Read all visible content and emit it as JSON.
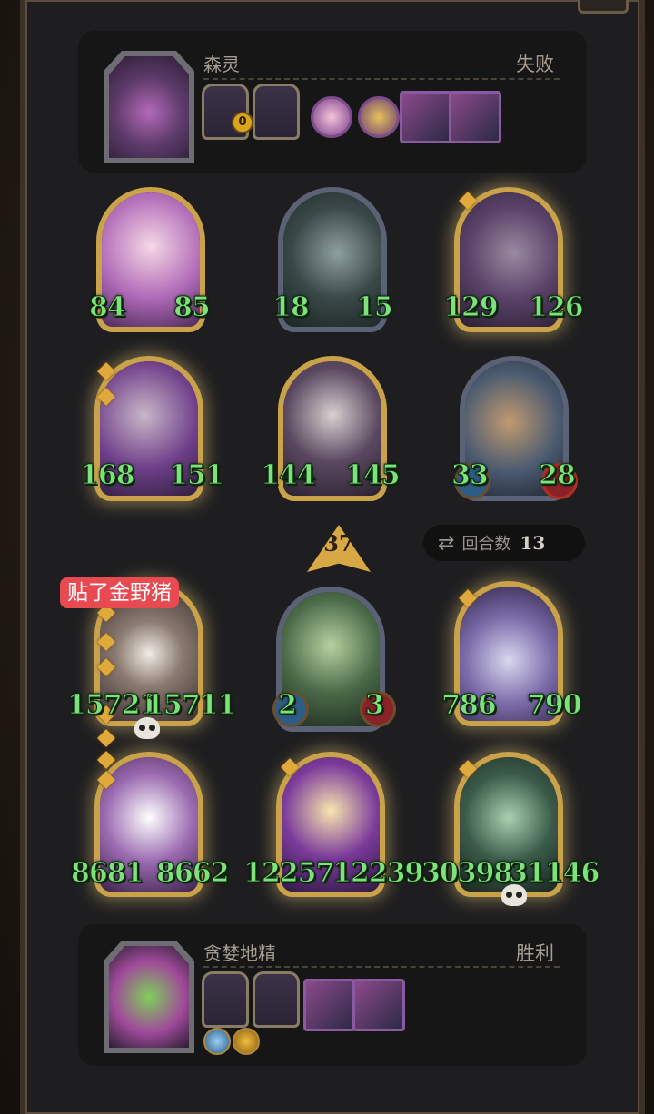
{
  "opponent": {
    "name": "森灵",
    "result": "失败",
    "coin_count": "0"
  },
  "player": {
    "name": "贪婪地精",
    "result": "胜利"
  },
  "tavern_tier": "37",
  "rounds": {
    "label": "回合数",
    "value": "13",
    "icon": "cycle-icon"
  },
  "tag": "贴了金野猪",
  "minions": [
    {
      "attack": "84",
      "health": "85"
    },
    {
      "attack": "18",
      "health": "15"
    },
    {
      "attack": "129",
      "health": "126"
    },
    {
      "attack": "168",
      "health": "151"
    },
    {
      "attack": "144",
      "health": "145"
    },
    {
      "attack": "33",
      "health": "28"
    },
    {
      "attack": "15721",
      "health": "15711"
    },
    {
      "attack": "2",
      "health": "3"
    },
    {
      "attack": "786",
      "health": "790"
    },
    {
      "attack": "8681",
      "health": "8662"
    },
    {
      "attack": "12257",
      "health": "12239"
    },
    {
      "attack": "30398",
      "health": "31146"
    }
  ],
  "colors": {
    "stat_green": "#7ee27a",
    "tag_red": "#e84a52",
    "gold_border": "#c9a24a",
    "panel": "#161616"
  }
}
